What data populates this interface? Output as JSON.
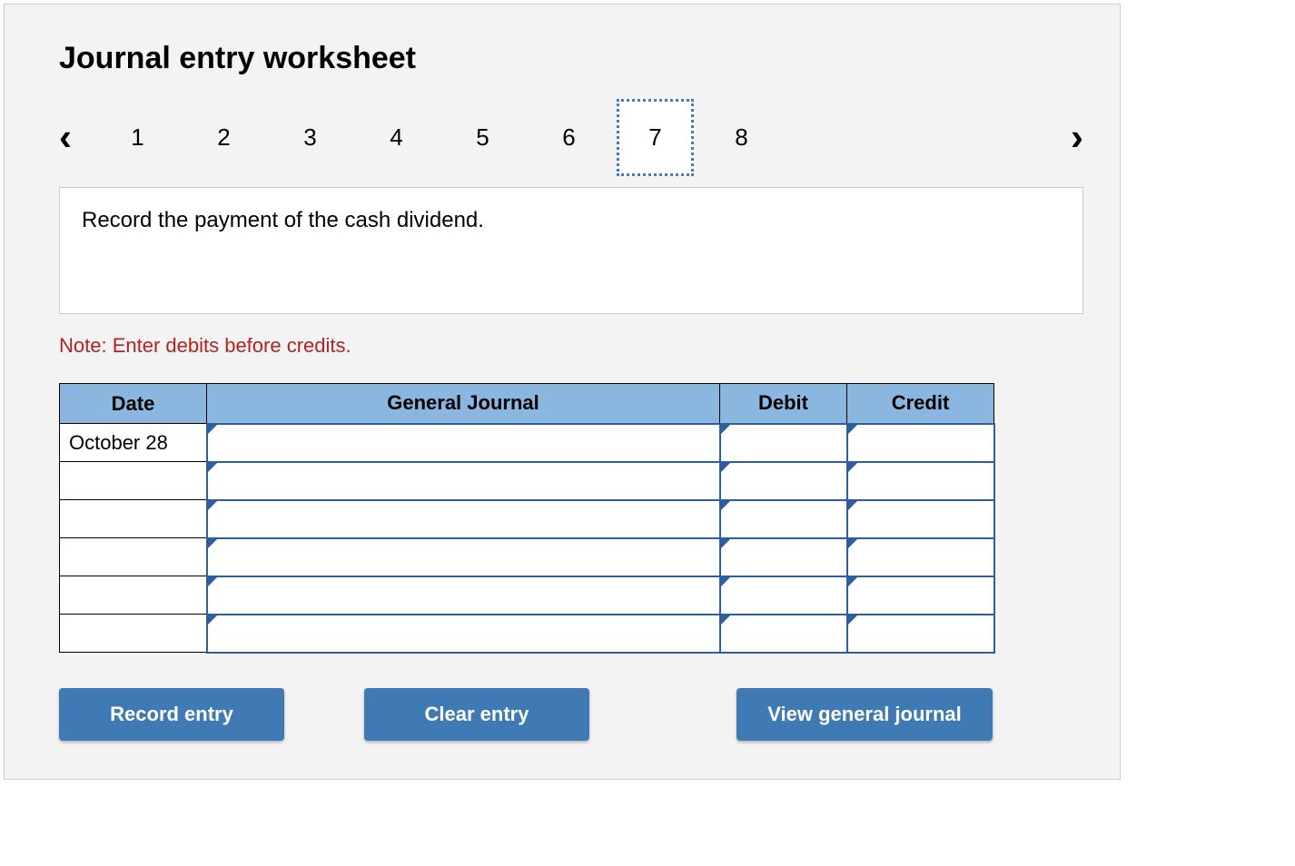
{
  "title": "Journal entry worksheet",
  "nav": {
    "steps": [
      "1",
      "2",
      "3",
      "4",
      "5",
      "6",
      "7",
      "8"
    ],
    "active_index": 6
  },
  "instruction": "Record the payment of the cash dividend.",
  "note": "Note: Enter debits before credits.",
  "table": {
    "headers": {
      "date": "Date",
      "gj": "General Journal",
      "debit": "Debit",
      "credit": "Credit"
    },
    "rows": [
      {
        "date": "October 28",
        "gj": "",
        "debit": "",
        "credit": ""
      },
      {
        "date": "",
        "gj": "",
        "debit": "",
        "credit": ""
      },
      {
        "date": "",
        "gj": "",
        "debit": "",
        "credit": ""
      },
      {
        "date": "",
        "gj": "",
        "debit": "",
        "credit": ""
      },
      {
        "date": "",
        "gj": "",
        "debit": "",
        "credit": ""
      },
      {
        "date": "",
        "gj": "",
        "debit": "",
        "credit": ""
      }
    ]
  },
  "buttons": {
    "record": "Record entry",
    "clear": "Clear entry",
    "view": "View general journal"
  }
}
